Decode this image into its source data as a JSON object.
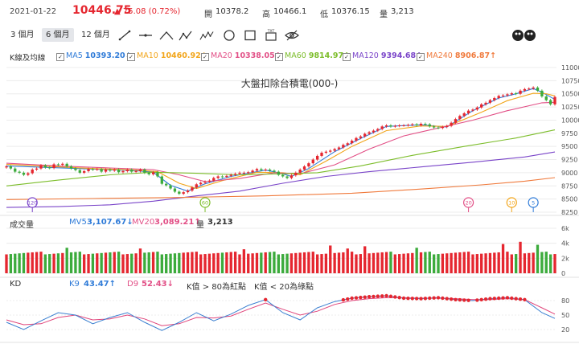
{
  "header": {
    "date": "2021-01-22",
    "price": "10446.75",
    "change": "▲ 75.08 (0.72%)",
    "open_label": "開",
    "open": "10378.2",
    "high_label": "高",
    "high": "10466.1",
    "low_label": "低",
    "low": "10376.15",
    "vol_label": "量",
    "vol": "3,213"
  },
  "toolbar": {
    "periods": [
      "3 個月",
      "6 個月",
      "12 個月"
    ],
    "active_period": "6 個月",
    "tools": [
      "line-tool-icon",
      "horizontal-line-icon",
      "curve-tool-icon",
      "wave-abc-icon",
      "wave-abcde-icon",
      "circle-tool-icon",
      "rectangle-tool-icon",
      "text-tool-icon",
      "hide-eye-icon"
    ],
    "text_tool_glyph": "TXT"
  },
  "legend": {
    "section_label": "K線及均線",
    "items": [
      {
        "label": "MA5",
        "value": "10393.20↓",
        "color": "#2f7bd8"
      },
      {
        "label": "MA10",
        "value": "10460.92↓",
        "color": "#f2a51a"
      },
      {
        "label": "MA20",
        "value": "10338.05↑",
        "color": "#e24f86"
      },
      {
        "label": "MA60",
        "value": "9814.97↑",
        "color": "#7cbd2a"
      },
      {
        "label": "MA120",
        "value": "9394.68↑",
        "color": "#7a45c9"
      },
      {
        "label": "MA240",
        "value": "8906.87↑",
        "color": "#f07a3c"
      }
    ]
  },
  "volume_panel": {
    "label": "成交量",
    "ma5_label": "MV5",
    "ma5_value": "3,107.67↓",
    "ma20_label": "MV20",
    "ma20_value": "3,089.21↑",
    "vol_label": "量",
    "vol_value": "3,213",
    "yticks": [
      "6k",
      "4k",
      "2k",
      "0"
    ]
  },
  "kd_panel": {
    "label": "KD",
    "k_label": "K9",
    "k_value": "43.47↑",
    "d_label": "D9",
    "d_value": "52.43↓",
    "note1": "K值 > 80為紅點",
    "note2": "K值 < 20為綠點",
    "yticks": [
      "80",
      "50",
      "20"
    ]
  },
  "colors": {
    "up": "#e5262f",
    "down": "#3cab3c",
    "k_line": "#3a7fd0",
    "d_line": "#e0457b",
    "grid": "#ececec"
  },
  "chart_data": {
    "type": "candlestick",
    "title": "大盤扣除台積電(000-)",
    "y_ticks": [
      8250,
      8500,
      8750,
      9000,
      9250,
      9500,
      9750,
      10000,
      10250,
      10500,
      10750,
      11000
    ],
    "ylim": [
      8250,
      11000
    ],
    "closes": [
      9120,
      9080,
      9020,
      9000,
      8960,
      8990,
      9060,
      9080,
      9140,
      9100,
      9090,
      9160,
      9150,
      9170,
      9120,
      9080,
      9050,
      9000,
      9030,
      9070,
      9060,
      9070,
      9020,
      9060,
      9040,
      9060,
      9010,
      9030,
      9060,
      9020,
      9030,
      9060,
      9000,
      8970,
      9010,
      8930,
      8790,
      8760,
      8700,
      8640,
      8600,
      8630,
      8660,
      8720,
      8780,
      8810,
      8830,
      8850,
      8900,
      8930,
      8920,
      8940,
      8960,
      8980,
      9000,
      9000,
      9010,
      9040,
      9070,
      9050,
      9060,
      9040,
      9020,
      8960,
      8930,
      8900,
      8950,
      9000,
      9060,
      9120,
      9180,
      9250,
      9320,
      9380,
      9400,
      9420,
      9450,
      9480,
      9530,
      9560,
      9610,
      9660,
      9690,
      9740,
      9770,
      9800,
      9830,
      9880,
      9900,
      9880,
      9890,
      9900,
      9900,
      9910,
      9920,
      9900,
      9930,
      9920,
      9880,
      9860,
      9850,
      9870,
      9890,
      9950,
      10020,
      10080,
      10130,
      10180,
      10200,
      10240,
      10300,
      10330,
      10380,
      10420,
      10460,
      10470,
      10490,
      10510,
      10500,
      10560,
      10590,
      10600,
      10620,
      10560,
      10450,
      10380,
      10300,
      10440
    ],
    "series": [
      {
        "name": "MA5",
        "points": [
          [
            0,
            9130
          ],
          [
            10,
            9100
          ],
          [
            20,
            9070
          ],
          [
            30,
            9040
          ],
          [
            34,
            9010
          ],
          [
            38,
            8760
          ],
          [
            42,
            8650
          ],
          [
            46,
            8790
          ],
          [
            52,
            8930
          ],
          [
            60,
            9050
          ],
          [
            64,
            8980
          ],
          [
            66,
            8930
          ],
          [
            70,
            9080
          ],
          [
            76,
            9400
          ],
          [
            82,
            9650
          ],
          [
            88,
            9880
          ],
          [
            96,
            9910
          ],
          [
            102,
            9870
          ],
          [
            108,
            10180
          ],
          [
            114,
            10420
          ],
          [
            118,
            10500
          ],
          [
            122,
            10600
          ],
          [
            124,
            10530
          ],
          [
            127,
            10393
          ]
        ]
      },
      {
        "name": "MA10",
        "points": [
          [
            0,
            9160
          ],
          [
            10,
            9120
          ],
          [
            20,
            9080
          ],
          [
            30,
            9050
          ],
          [
            35,
            9020
          ],
          [
            40,
            8800
          ],
          [
            44,
            8700
          ],
          [
            50,
            8850
          ],
          [
            58,
            9010
          ],
          [
            64,
            9000
          ],
          [
            68,
            8960
          ],
          [
            74,
            9220
          ],
          [
            80,
            9500
          ],
          [
            88,
            9800
          ],
          [
            96,
            9890
          ],
          [
            102,
            9880
          ],
          [
            110,
            10150
          ],
          [
            116,
            10370
          ],
          [
            122,
            10510
          ],
          [
            125,
            10500
          ],
          [
            127,
            10460
          ]
        ]
      },
      {
        "name": "MA20",
        "points": [
          [
            0,
            9180
          ],
          [
            12,
            9130
          ],
          [
            24,
            9090
          ],
          [
            34,
            9060
          ],
          [
            40,
            8960
          ],
          [
            46,
            8830
          ],
          [
            54,
            8890
          ],
          [
            62,
            9000
          ],
          [
            68,
            8980
          ],
          [
            76,
            9150
          ],
          [
            84,
            9450
          ],
          [
            92,
            9700
          ],
          [
            100,
            9850
          ],
          [
            108,
            10000
          ],
          [
            116,
            10180
          ],
          [
            124,
            10330
          ],
          [
            127,
            10338
          ]
        ]
      },
      {
        "name": "MA60",
        "points": [
          [
            0,
            8750
          ],
          [
            12,
            8860
          ],
          [
            24,
            8960
          ],
          [
            34,
            9010
          ],
          [
            44,
            8990
          ],
          [
            54,
            8960
          ],
          [
            64,
            8980
          ],
          [
            72,
            9000
          ],
          [
            82,
            9130
          ],
          [
            94,
            9330
          ],
          [
            106,
            9500
          ],
          [
            118,
            9660
          ],
          [
            127,
            9815
          ]
        ]
      },
      {
        "name": "MA120",
        "points": [
          [
            0,
            8340
          ],
          [
            12,
            8355
          ],
          [
            24,
            8390
          ],
          [
            34,
            8460
          ],
          [
            44,
            8560
          ],
          [
            54,
            8650
          ],
          [
            64,
            8800
          ],
          [
            74,
            8930
          ],
          [
            84,
            9020
          ],
          [
            96,
            9110
          ],
          [
            108,
            9200
          ],
          [
            120,
            9300
          ],
          [
            127,
            9395
          ]
        ]
      },
      {
        "name": "MA240",
        "points": [
          [
            0,
            8490
          ],
          [
            20,
            8510
          ],
          [
            40,
            8530
          ],
          [
            60,
            8560
          ],
          [
            80,
            8610
          ],
          [
            96,
            8690
          ],
          [
            110,
            8770
          ],
          [
            120,
            8840
          ],
          [
            127,
            8907
          ]
        ]
      }
    ],
    "markers": [
      {
        "label": "120",
        "index": 6,
        "color": "#7a45c9"
      },
      {
        "label": "60",
        "index": 46,
        "color": "#7cbd2a"
      },
      {
        "label": "20",
        "index": 107,
        "color": "#e24f86"
      },
      {
        "label": "10",
        "index": 117,
        "color": "#f2a51a"
      },
      {
        "label": "5",
        "index": 122,
        "color": "#2f7bd8"
      }
    ],
    "volume": {
      "ylim": [
        0,
        6000
      ],
      "yticks": [
        0,
        2000,
        4000,
        6000
      ],
      "bar_level": 2700,
      "bar_peaks": [
        [
          14,
          3400
        ],
        [
          31,
          3300
        ],
        [
          55,
          3200
        ],
        [
          75,
          3700
        ],
        [
          79,
          3300
        ],
        [
          83,
          3600
        ],
        [
          95,
          3400
        ],
        [
          115,
          3900
        ],
        [
          119,
          4200
        ],
        [
          123,
          3800
        ]
      ]
    },
    "kd": {
      "ylim": [
        0,
        100
      ],
      "k": [
        [
          0,
          35
        ],
        [
          4,
          20
        ],
        [
          8,
          38
        ],
        [
          12,
          55
        ],
        [
          16,
          50
        ],
        [
          20,
          32
        ],
        [
          24,
          45
        ],
        [
          28,
          55
        ],
        [
          32,
          35
        ],
        [
          36,
          18
        ],
        [
          40,
          35
        ],
        [
          44,
          55
        ],
        [
          48,
          38
        ],
        [
          52,
          52
        ],
        [
          56,
          70
        ],
        [
          60,
          82
        ],
        [
          64,
          55
        ],
        [
          68,
          40
        ],
        [
          72,
          65
        ],
        [
          76,
          78
        ],
        [
          80,
          85
        ],
        [
          84,
          88
        ],
        [
          88,
          90
        ],
        [
          92,
          85
        ],
        [
          96,
          84
        ],
        [
          100,
          86
        ],
        [
          104,
          82
        ],
        [
          108,
          80
        ],
        [
          112,
          84
        ],
        [
          116,
          86
        ],
        [
          120,
          82
        ],
        [
          124,
          55
        ],
        [
          127,
          43
        ]
      ],
      "d": [
        [
          0,
          40
        ],
        [
          4,
          30
        ],
        [
          8,
          32
        ],
        [
          12,
          45
        ],
        [
          16,
          50
        ],
        [
          20,
          40
        ],
        [
          24,
          42
        ],
        [
          28,
          50
        ],
        [
          32,
          42
        ],
        [
          36,
          28
        ],
        [
          40,
          32
        ],
        [
          44,
          45
        ],
        [
          48,
          44
        ],
        [
          52,
          48
        ],
        [
          56,
          62
        ],
        [
          60,
          75
        ],
        [
          64,
          62
        ],
        [
          68,
          50
        ],
        [
          72,
          58
        ],
        [
          76,
          72
        ],
        [
          80,
          80
        ],
        [
          84,
          84
        ],
        [
          88,
          86
        ],
        [
          92,
          86
        ],
        [
          96,
          85
        ],
        [
          100,
          85
        ],
        [
          104,
          84
        ],
        [
          108,
          82
        ],
        [
          112,
          82
        ],
        [
          116,
          84
        ],
        [
          120,
          82
        ],
        [
          124,
          65
        ],
        [
          127,
          52
        ]
      ]
    }
  }
}
